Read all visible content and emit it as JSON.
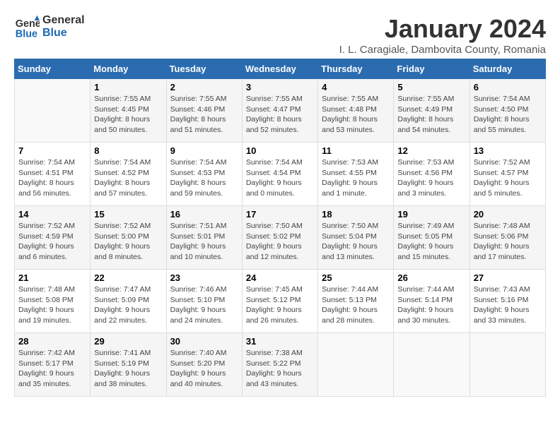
{
  "logo": {
    "line1": "General",
    "line2": "Blue"
  },
  "title": "January 2024",
  "subtitle": "I. L. Caragiale, Dambovita County, Romania",
  "weekdays": [
    "Sunday",
    "Monday",
    "Tuesday",
    "Wednesday",
    "Thursday",
    "Friday",
    "Saturday"
  ],
  "weeks": [
    [
      {
        "day": null,
        "info": null
      },
      {
        "day": "1",
        "info": "Sunrise: 7:55 AM\nSunset: 4:45 PM\nDaylight: 8 hours\nand 50 minutes."
      },
      {
        "day": "2",
        "info": "Sunrise: 7:55 AM\nSunset: 4:46 PM\nDaylight: 8 hours\nand 51 minutes."
      },
      {
        "day": "3",
        "info": "Sunrise: 7:55 AM\nSunset: 4:47 PM\nDaylight: 8 hours\nand 52 minutes."
      },
      {
        "day": "4",
        "info": "Sunrise: 7:55 AM\nSunset: 4:48 PM\nDaylight: 8 hours\nand 53 minutes."
      },
      {
        "day": "5",
        "info": "Sunrise: 7:55 AM\nSunset: 4:49 PM\nDaylight: 8 hours\nand 54 minutes."
      },
      {
        "day": "6",
        "info": "Sunrise: 7:54 AM\nSunset: 4:50 PM\nDaylight: 8 hours\nand 55 minutes."
      }
    ],
    [
      {
        "day": "7",
        "info": "Sunrise: 7:54 AM\nSunset: 4:51 PM\nDaylight: 8 hours\nand 56 minutes."
      },
      {
        "day": "8",
        "info": "Sunrise: 7:54 AM\nSunset: 4:52 PM\nDaylight: 8 hours\nand 57 minutes."
      },
      {
        "day": "9",
        "info": "Sunrise: 7:54 AM\nSunset: 4:53 PM\nDaylight: 8 hours\nand 59 minutes."
      },
      {
        "day": "10",
        "info": "Sunrise: 7:54 AM\nSunset: 4:54 PM\nDaylight: 9 hours\nand 0 minutes."
      },
      {
        "day": "11",
        "info": "Sunrise: 7:53 AM\nSunset: 4:55 PM\nDaylight: 9 hours\nand 1 minute."
      },
      {
        "day": "12",
        "info": "Sunrise: 7:53 AM\nSunset: 4:56 PM\nDaylight: 9 hours\nand 3 minutes."
      },
      {
        "day": "13",
        "info": "Sunrise: 7:52 AM\nSunset: 4:57 PM\nDaylight: 9 hours\nand 5 minutes."
      }
    ],
    [
      {
        "day": "14",
        "info": "Sunrise: 7:52 AM\nSunset: 4:59 PM\nDaylight: 9 hours\nand 6 minutes."
      },
      {
        "day": "15",
        "info": "Sunrise: 7:52 AM\nSunset: 5:00 PM\nDaylight: 9 hours\nand 8 minutes."
      },
      {
        "day": "16",
        "info": "Sunrise: 7:51 AM\nSunset: 5:01 PM\nDaylight: 9 hours\nand 10 minutes."
      },
      {
        "day": "17",
        "info": "Sunrise: 7:50 AM\nSunset: 5:02 PM\nDaylight: 9 hours\nand 12 minutes."
      },
      {
        "day": "18",
        "info": "Sunrise: 7:50 AM\nSunset: 5:04 PM\nDaylight: 9 hours\nand 13 minutes."
      },
      {
        "day": "19",
        "info": "Sunrise: 7:49 AM\nSunset: 5:05 PM\nDaylight: 9 hours\nand 15 minutes."
      },
      {
        "day": "20",
        "info": "Sunrise: 7:48 AM\nSunset: 5:06 PM\nDaylight: 9 hours\nand 17 minutes."
      }
    ],
    [
      {
        "day": "21",
        "info": "Sunrise: 7:48 AM\nSunset: 5:08 PM\nDaylight: 9 hours\nand 19 minutes."
      },
      {
        "day": "22",
        "info": "Sunrise: 7:47 AM\nSunset: 5:09 PM\nDaylight: 9 hours\nand 22 minutes."
      },
      {
        "day": "23",
        "info": "Sunrise: 7:46 AM\nSunset: 5:10 PM\nDaylight: 9 hours\nand 24 minutes."
      },
      {
        "day": "24",
        "info": "Sunrise: 7:45 AM\nSunset: 5:12 PM\nDaylight: 9 hours\nand 26 minutes."
      },
      {
        "day": "25",
        "info": "Sunrise: 7:44 AM\nSunset: 5:13 PM\nDaylight: 9 hours\nand 28 minutes."
      },
      {
        "day": "26",
        "info": "Sunrise: 7:44 AM\nSunset: 5:14 PM\nDaylight: 9 hours\nand 30 minutes."
      },
      {
        "day": "27",
        "info": "Sunrise: 7:43 AM\nSunset: 5:16 PM\nDaylight: 9 hours\nand 33 minutes."
      }
    ],
    [
      {
        "day": "28",
        "info": "Sunrise: 7:42 AM\nSunset: 5:17 PM\nDaylight: 9 hours\nand 35 minutes."
      },
      {
        "day": "29",
        "info": "Sunrise: 7:41 AM\nSunset: 5:19 PM\nDaylight: 9 hours\nand 38 minutes."
      },
      {
        "day": "30",
        "info": "Sunrise: 7:40 AM\nSunset: 5:20 PM\nDaylight: 9 hours\nand 40 minutes."
      },
      {
        "day": "31",
        "info": "Sunrise: 7:38 AM\nSunset: 5:22 PM\nDaylight: 9 hours\nand 43 minutes."
      },
      {
        "day": null,
        "info": null
      },
      {
        "day": null,
        "info": null
      },
      {
        "day": null,
        "info": null
      }
    ]
  ]
}
